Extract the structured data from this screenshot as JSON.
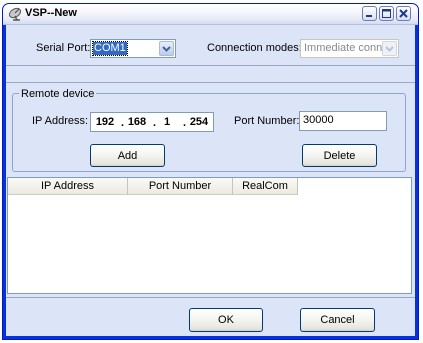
{
  "window": {
    "title": "VSP--New",
    "icon": "satellite-dish-icon",
    "controls": [
      "minimize-icon",
      "maximize-icon",
      "close-icon"
    ]
  },
  "serial": {
    "label": "Serial Port:",
    "value": "COM1"
  },
  "connection": {
    "label": "Connection modes:",
    "value": "Immediate conn"
  },
  "remote": {
    "group_label": "Remote device",
    "ip_label": "IP Address:",
    "ip": [
      "192",
      "168",
      "1",
      "254"
    ],
    "port_label": "Port Number:",
    "port_value": "30000",
    "add_label": "Add",
    "delete_label": "Delete"
  },
  "list": {
    "columns": [
      "IP Address",
      "Port Number",
      "RealCom"
    ],
    "rows": []
  },
  "footer": {
    "ok_label": "OK",
    "cancel_label": "Cancel"
  },
  "colors": {
    "titlebar": "#f6f7fc",
    "client": "#dce5f7",
    "frame": "#0831d9",
    "selection": "#316ac5"
  }
}
